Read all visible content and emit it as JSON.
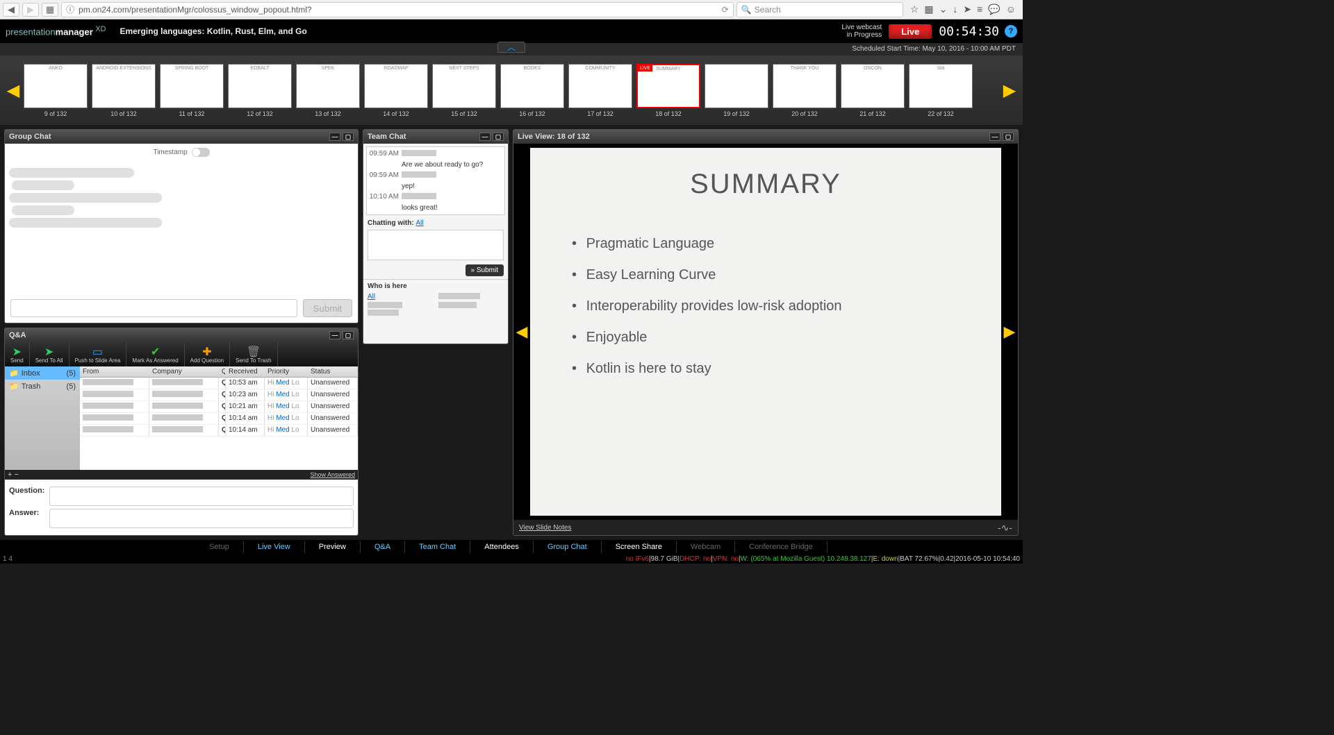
{
  "browser": {
    "url": "pm.on24.com/presentationMgr/colossus_window_popout.html?",
    "search_placeholder": "Search"
  },
  "header": {
    "logo_pre": "presentation",
    "logo_bold": "manager",
    "logo_suffix": "XD",
    "title": "Emerging languages: Kotlin, Rust, Elm, and Go",
    "status_line1": "Live webcast",
    "status_line2": "in Progress",
    "live_label": "Live",
    "timer": "00:54:30"
  },
  "subheader": {
    "scheduled": "Scheduled Start Time: May 10, 2016 - 10:00 AM PDT"
  },
  "filmstrip": {
    "total": 132,
    "thumbs": [
      {
        "n": 9,
        "title": "ANKO"
      },
      {
        "n": 10,
        "title": "ANDROID EXTENSIONS"
      },
      {
        "n": 11,
        "title": "SPRING BOOT"
      },
      {
        "n": 12,
        "title": "KOBALT"
      },
      {
        "n": 13,
        "title": "SPEK"
      },
      {
        "n": 14,
        "title": "ROADMAP"
      },
      {
        "n": 15,
        "title": "NEXT STEPS"
      },
      {
        "n": 16,
        "title": "BOOKS"
      },
      {
        "n": 17,
        "title": "COMMUNITY"
      },
      {
        "n": 18,
        "title": "SUMMARY",
        "live": true,
        "selected": true
      },
      {
        "n": 19,
        "title": ""
      },
      {
        "n": 20,
        "title": "THANK YOU"
      },
      {
        "n": 21,
        "title": "OSCON"
      },
      {
        "n": 22,
        "title": "Sta"
      }
    ]
  },
  "group_chat": {
    "title": "Group Chat",
    "timestamp_label": "Timestamp",
    "submit": "Submit"
  },
  "team_chat": {
    "title": "Team Chat",
    "messages": [
      {
        "time": "09:59 AM",
        "text": ""
      },
      {
        "time": "",
        "text": "Are we about ready to go?"
      },
      {
        "time": "09:59 AM",
        "text": ""
      },
      {
        "time": "",
        "text": "yep!"
      },
      {
        "time": "10:10 AM",
        "text": ""
      },
      {
        "time": "",
        "text": "looks great!"
      }
    ],
    "chatting_with": "Chatting with:",
    "all": "All",
    "submit": "» Submit",
    "who_label": "Who is here"
  },
  "live_view": {
    "title": "Live View: 18 of 132",
    "slide_title": "SUMMARY",
    "bullets": [
      "Pragmatic Language",
      "Easy Learning Curve",
      "Interoperability provides low-risk adoption",
      "Enjoyable",
      "Kotlin is here to stay"
    ],
    "notes_link": "View Slide Notes"
  },
  "qa": {
    "title": "Q&A",
    "tools": [
      {
        "icon": "➤",
        "label": "Send",
        "color": "#3c6"
      },
      {
        "icon": "➤",
        "label": "Send To All",
        "color": "#3c6"
      },
      {
        "icon": "▭",
        "label": "Push to Slide Area",
        "color": "#39f"
      },
      {
        "icon": "✔",
        "label": "Mark As Answered",
        "color": "#3c3"
      },
      {
        "icon": "✚",
        "label": "Add Question",
        "color": "#f90"
      },
      {
        "icon": "🗑",
        "label": "Send To Trash",
        "color": "#888"
      }
    ],
    "folders": [
      {
        "name": "Inbox",
        "count": "(5)",
        "active": true
      },
      {
        "name": "Trash",
        "count": "(5)"
      }
    ],
    "columns": [
      "From",
      "Company",
      "Question",
      "Received",
      "Priority",
      "Status"
    ],
    "rows": [
      {
        "q": "Q is 'sealed' like 'final'? the same as n",
        "recv": "10:53 am",
        "stat": "Unanswered"
      },
      {
        "q": "Q You mentioned that Kotlin is a stand",
        "recv": "10:23 am",
        "stat": "Unanswered"
      },
      {
        "q": "Q what about singleExpression(x: Int) :",
        "recv": "10:21 am",
        "stat": "Unanswered"
      },
      {
        "q": "Q How do you protect data members?",
        "recv": "10:14 am",
        "stat": "Unanswered"
      },
      {
        "q": "Q: sure would like to see its Javscript",
        "recv": "10:14 am",
        "stat": "Unanswered"
      }
    ],
    "priority": {
      "hi": "Hi",
      "med": "Med",
      "lo": "Lo"
    },
    "show_answered": "Show Answered",
    "question_label": "Question:",
    "answer_label": "Answer:"
  },
  "tabs": [
    "Setup",
    "Live View",
    "Preview",
    "Q&A",
    "Team Chat",
    "Attendees",
    "Group Chat",
    "Screen Share",
    "Webcam",
    "Conference Bridge"
  ],
  "tabs_active": [
    1,
    3,
    4,
    6
  ],
  "tabs_dim": [
    0,
    8,
    9
  ],
  "statusline": {
    "left": "1  4",
    "parts": [
      {
        "cls": "seg-r",
        "t": "no IFv6"
      },
      {
        "cls": "seg-w",
        "t": "|98.7 GiB|"
      },
      {
        "cls": "seg-r",
        "t": "DHCP: no"
      },
      {
        "cls": "seg-w",
        "t": "|"
      },
      {
        "cls": "seg-r",
        "t": "VPN: no"
      },
      {
        "cls": "seg-w",
        "t": "|"
      },
      {
        "cls": "seg-g",
        "t": "W: (065% at Mozilla Guest) 10.248.38.127"
      },
      {
        "cls": "seg-w",
        "t": "|"
      },
      {
        "cls": "seg-y",
        "t": "E: down"
      },
      {
        "cls": "seg-w",
        "t": "|BAT 72.67%|0.42|2016-05-10 10:54:40"
      }
    ]
  }
}
